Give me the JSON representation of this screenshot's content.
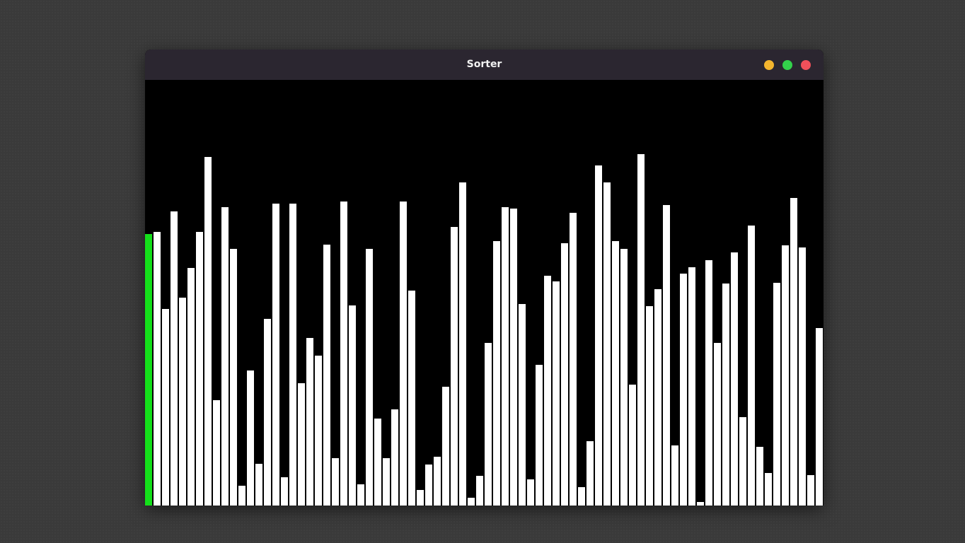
{
  "window": {
    "title": "Sorter",
    "controls": [
      {
        "name": "minimize-button",
        "icon": "minimize-dot-icon",
        "color": "#f4b52e"
      },
      {
        "name": "maximize-button",
        "icon": "maximize-dot-icon",
        "color": "#33d14b"
      },
      {
        "name": "close-button",
        "icon": "close-dot-icon",
        "color": "#f0505a"
      }
    ]
  },
  "visualization": {
    "bar_color": "#ffffff",
    "highlight_color": "#14e01a",
    "highlighted_index": 0,
    "max_value": 602,
    "values": [
      384,
      387,
      278,
      416,
      294,
      336,
      387,
      493,
      149,
      422,
      363,
      28,
      191,
      59,
      264,
      427,
      40,
      427,
      173,
      237,
      212,
      369,
      67,
      430,
      283,
      30,
      363,
      123,
      67,
      136,
      430,
      304,
      22,
      58,
      69,
      168,
      394,
      457,
      11,
      42,
      230,
      374,
      422,
      420,
      285,
      37,
      199,
      325,
      317,
      371,
      414,
      26,
      91,
      481,
      457,
      374,
      363,
      171,
      497,
      282,
      306,
      425,
      85,
      328,
      337,
      5,
      347,
      230,
      314,
      358,
      125,
      396,
      83,
      46,
      315,
      368,
      435,
      365,
      43,
      251
    ]
  }
}
